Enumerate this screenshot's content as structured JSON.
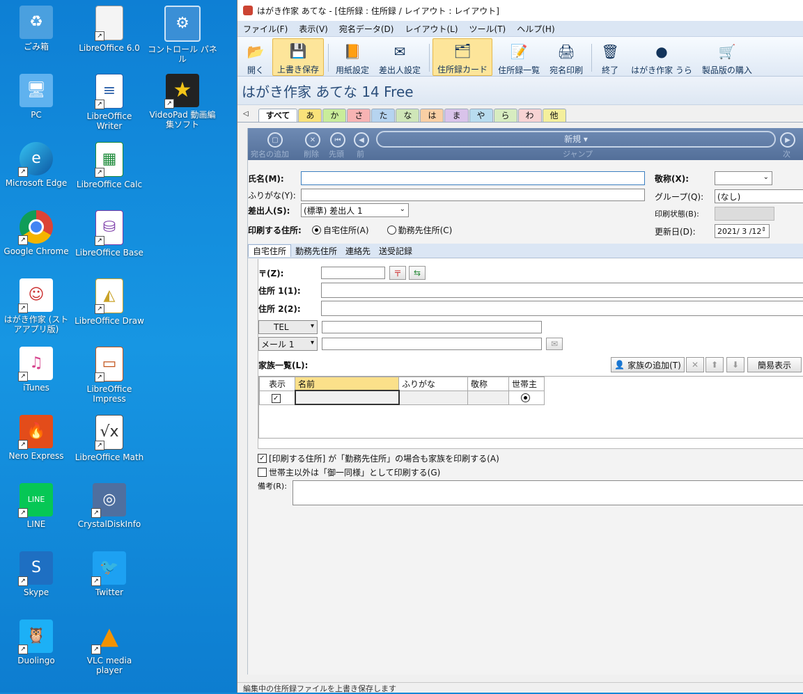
{
  "desktop": {
    "icons": [
      {
        "label": "ごみ箱",
        "icon": "recycle-bin-icon"
      },
      {
        "label": "LibreOffice 6.0",
        "icon": "file-icon"
      },
      {
        "label": "コントロール パネル",
        "icon": "control-panel-icon"
      },
      {
        "label": "PC",
        "icon": "pc-icon"
      },
      {
        "label": "LibreOffice Writer",
        "icon": "writer-icon"
      },
      {
        "label": "VideoPad 動画編集ソフト",
        "icon": "star-icon"
      },
      {
        "label": "Microsoft Edge",
        "icon": "edge-icon"
      },
      {
        "label": "LibreOffice Calc",
        "icon": "calc-icon"
      },
      {
        "label": "Google Chrome",
        "icon": "chrome-icon"
      },
      {
        "label": "LibreOffice Base",
        "icon": "base-icon"
      },
      {
        "label": "はがき作家 (ストアアプリ版)",
        "icon": "hagaki-icon"
      },
      {
        "label": "LibreOffice Draw",
        "icon": "draw-icon"
      },
      {
        "label": "iTunes",
        "icon": "itunes-icon"
      },
      {
        "label": "LibreOffice Impress",
        "icon": "impress-icon"
      },
      {
        "label": "Nero Express",
        "icon": "nero-icon"
      },
      {
        "label": "LibreOffice Math",
        "icon": "math-icon"
      },
      {
        "label": "LINE",
        "icon": "line-icon"
      },
      {
        "label": "CrystalDiskInfo",
        "icon": "crystaldisk-icon"
      },
      {
        "label": "Skype",
        "icon": "skype-icon"
      },
      {
        "label": "Twitter",
        "icon": "twitter-icon"
      },
      {
        "label": "Duolingo",
        "icon": "duolingo-icon"
      },
      {
        "label": "VLC media player",
        "icon": "vlc-icon"
      }
    ]
  },
  "window": {
    "title": "はがき作家 あてな - [住所録 : 住所録 / レイアウト : レイアウト]",
    "menu": [
      "ファイル(F)",
      "表示(V)",
      "宛名データ(D)",
      "レイアウト(L)",
      "ツール(T)",
      "ヘルプ(H)"
    ],
    "toolbar": [
      {
        "label": "開く",
        "icon": "folder-icon"
      },
      {
        "label": "上書き保存",
        "icon": "floppy-icon"
      },
      {
        "label": "用紙設定",
        "icon": "paper-icon"
      },
      {
        "label": "差出人設定",
        "icon": "sender-icon"
      },
      {
        "label": "住所録カード",
        "icon": "cards-icon"
      },
      {
        "label": "住所録一覧",
        "icon": "list-icon"
      },
      {
        "label": "宛名印刷",
        "icon": "printer-icon"
      },
      {
        "label": "終了",
        "icon": "exit-icon"
      },
      {
        "label": "はがき作家 うら",
        "icon": "ura-icon"
      },
      {
        "label": "製品版の購入",
        "icon": "cart-icon"
      }
    ],
    "app_title": "はがき作家 あてな 14 Free",
    "index_tabs": [
      {
        "label": "すべて",
        "color": "#ffffff"
      },
      {
        "label": "あ",
        "color": "#f9e27a"
      },
      {
        "label": "か",
        "color": "#c9ec9a"
      },
      {
        "label": "さ",
        "color": "#f7b3b3"
      },
      {
        "label": "た",
        "color": "#b6d4f0"
      },
      {
        "label": "な",
        "color": "#cfe6b8"
      },
      {
        "label": "は",
        "color": "#f9cfa4"
      },
      {
        "label": "ま",
        "color": "#d9c3ea"
      },
      {
        "label": "や",
        "color": "#b8dcef"
      },
      {
        "label": "ら",
        "color": "#d7ecc0"
      },
      {
        "label": "わ",
        "color": "#f7d3d3"
      },
      {
        "label": "他",
        "color": "#f4ef9c"
      }
    ],
    "nav": {
      "add": "宛名の追加",
      "delete": "削除",
      "first": "先頭",
      "prev": "前",
      "jump_value": "新規",
      "jump_label": "ジャンプ",
      "next": "次"
    },
    "form": {
      "name_label": "氏名(M):",
      "kana_label": "ふりがな(Y):",
      "sender_label": "差出人(S):",
      "sender_value": "(標準) 差出人 1",
      "print_addr_label": "印刷する住所:",
      "home_radio": "自宅住所(A)",
      "work_radio": "勤務先住所(C)",
      "honorific_label": "敬称(X):",
      "honorific_value": "",
      "group_label": "グループ(Q):",
      "group_value": "(なし)",
      "print_state_label": "印刷状態(B):",
      "updated_label": "更新日(D):",
      "updated_value": "2021/ 3 /12"
    },
    "subtabs": [
      "自宅住所",
      "勤務先住所",
      "連絡先",
      "送受記録"
    ],
    "address": {
      "zip_label": "〒(Z):",
      "addr1_label": "住所 1(1):",
      "addr2_label": "住所 2(2):",
      "tel_type": "TEL",
      "mail_type": "メール 1"
    },
    "family": {
      "label": "家族一覧(L):",
      "add_button": "家族の追加(T)",
      "simple_button": "簡易表示",
      "columns": [
        "表示",
        "名前",
        "ふりがな",
        "敬称",
        "世帯主"
      ]
    },
    "options": {
      "opt1": "[印刷する住所] が「勤務先住所」の場合も家族を印刷する(A)",
      "opt2": "世帯主以外は「御一同様」として印刷する(G)"
    },
    "memo_label": "備考(R):",
    "status": "編集中の住所録ファイルを上書き保存します"
  }
}
